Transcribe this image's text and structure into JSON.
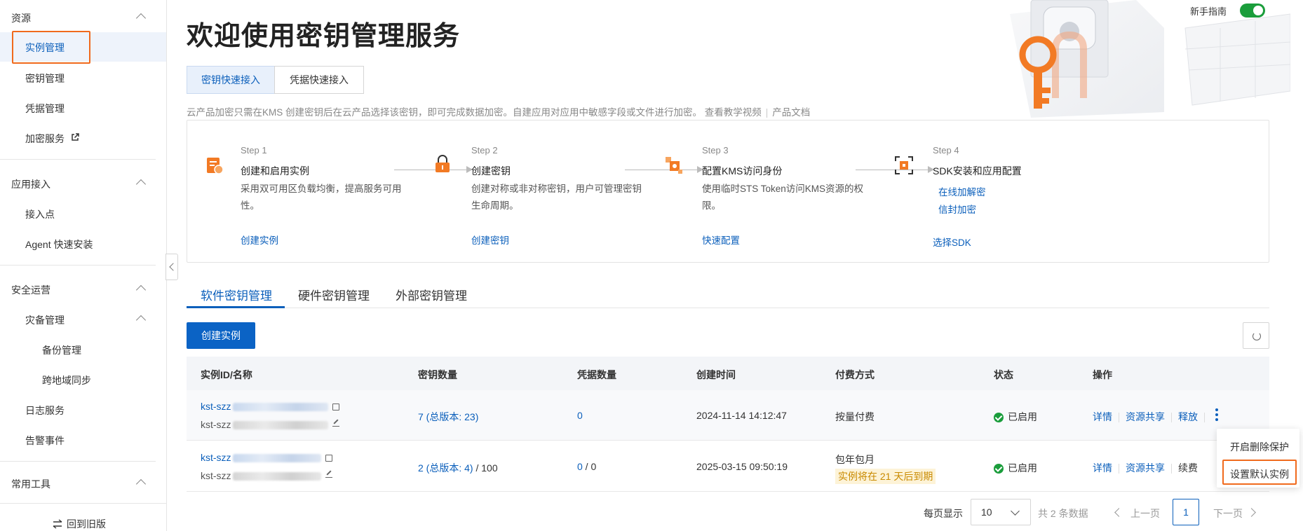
{
  "sidebar": {
    "groups": [
      {
        "title": "资源",
        "items": [
          "实例管理",
          "密钥管理",
          "凭据管理",
          "加密服务"
        ]
      },
      {
        "title": "应用接入",
        "items": [
          "接入点",
          "Agent 快速安装"
        ]
      },
      {
        "title": "安全运营",
        "items": [
          "灾备管理",
          "备份管理",
          "跨地域同步",
          "日志服务",
          "告警事件"
        ]
      },
      {
        "title": "常用工具",
        "items": []
      }
    ],
    "back_old": "回到旧版"
  },
  "header": {
    "title": "欢迎使用密钥管理服务",
    "guide_label": "新手指南"
  },
  "segments": [
    "密钥快速接入",
    "凭据快速接入"
  ],
  "desc": {
    "text": "云产品加密只需在KMS 创建密钥后在云产品选择该密钥，即可完成数据加密。自建应用对应用中敏感字段或文件进行加密。",
    "video_link": "查看教学视频",
    "doc_link": "产品文档"
  },
  "steps": [
    {
      "no": "Step 1",
      "title": "创建和启用实例",
      "desc": "采用双可用区负载均衡，提高服务可用性。",
      "links": [
        "创建实例"
      ]
    },
    {
      "no": "Step 2",
      "title": "创建密钥",
      "desc": "创建对称或非对称密钥，用户可管理密钥生命周期。",
      "links": [
        "创建密钥"
      ]
    },
    {
      "no": "Step 3",
      "title": "配置KMS访问身份",
      "desc": "使用临时STS Token访问KMS资源的权限。",
      "links": [
        "快速配置"
      ]
    },
    {
      "no": "Step 4",
      "title": "SDK安装和应用配置",
      "desc": "",
      "links": [
        "在线加解密",
        "信封加密",
        "选择SDK"
      ]
    }
  ],
  "tabs": [
    "软件密钥管理",
    "硬件密钥管理",
    "外部密钥管理"
  ],
  "create_button": "创建实例",
  "table": {
    "columns": [
      "实例ID/名称",
      "密钥数量",
      "凭据数量",
      "创建时间",
      "付费方式",
      "状态",
      "操作"
    ],
    "rows": [
      {
        "id": "kst-szz",
        "name": "kst-szz",
        "keys": "7 (总版本: 23)",
        "keys_limit": "",
        "creds": "0",
        "creds_limit": "",
        "created": "2024-11-14 14:12:47",
        "billing": "按量付费",
        "billing_note": "",
        "status": "已启用",
        "ops": [
          "详情",
          "资源共享",
          "释放"
        ]
      },
      {
        "id": "kst-szz",
        "name": "kst-szz",
        "keys": "2 (总版本: 4)",
        "keys_limit": " / 100",
        "creds": "0",
        "creds_limit": " / 0",
        "created": "2025-03-15 09:50:19",
        "billing": "包年包月",
        "billing_note": "实例将在 21 天后到期",
        "status": "已启用",
        "ops": [
          "详情",
          "资源共享",
          "续费"
        ]
      }
    ]
  },
  "dropdown": [
    "开启删除保护",
    "设置默认实例"
  ],
  "pager": {
    "per_page_label": "每页显示",
    "per_page": "10",
    "total": "共 2 条数据",
    "prev": "上一页",
    "page": "1",
    "next": "下一页"
  },
  "colors": {
    "accent": "#0b5fbb",
    "highlight": "#f06a1d",
    "success": "#1a9d3b"
  }
}
